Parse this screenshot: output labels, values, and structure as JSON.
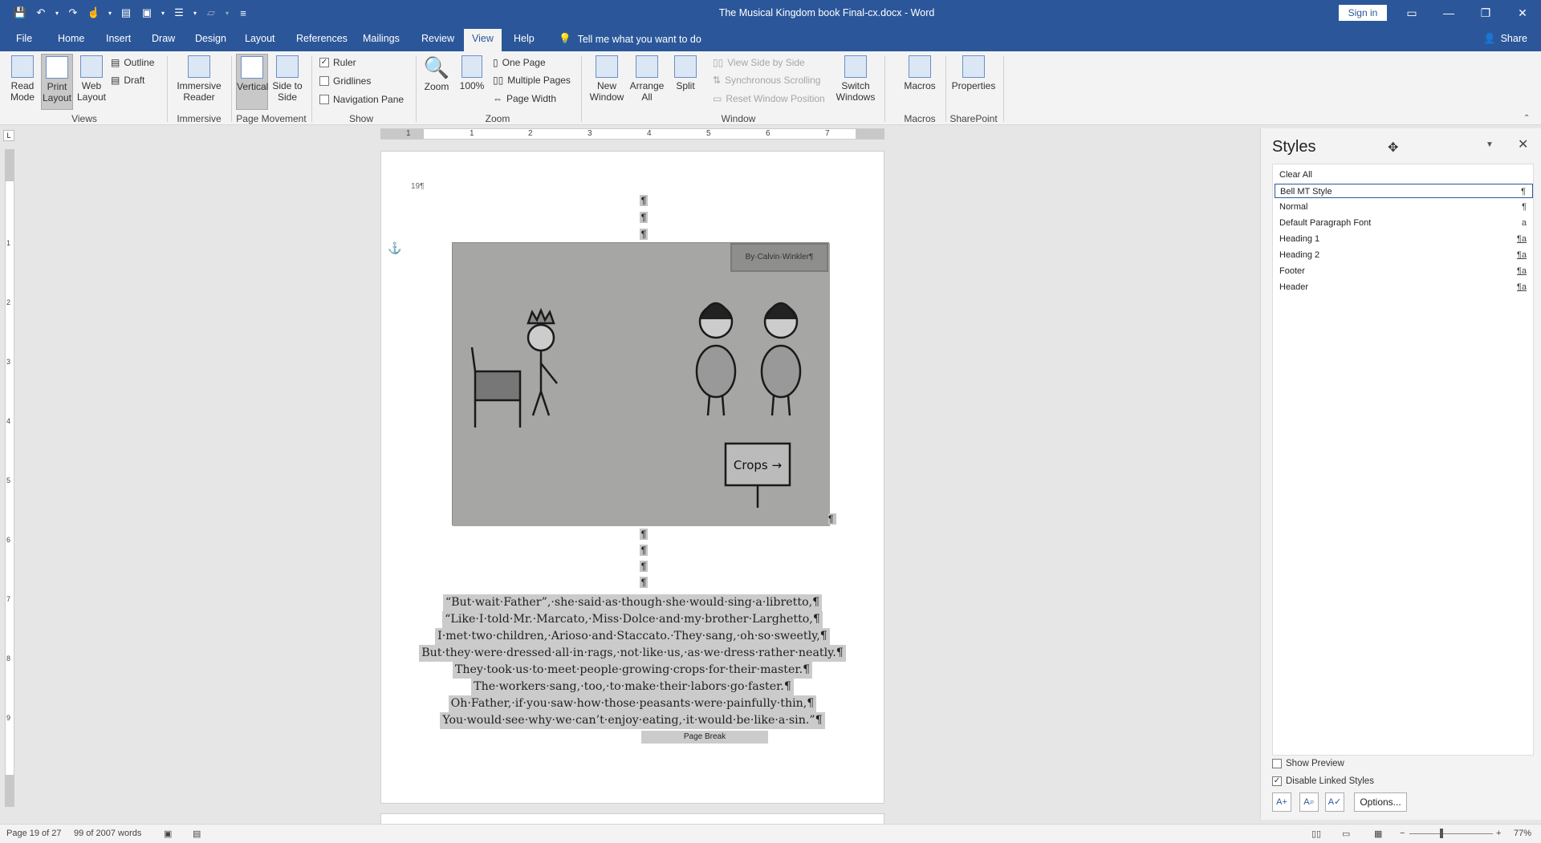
{
  "titlebar": {
    "doc_title": "The Musical Kingdom book Final-cx.docx  -  Word",
    "sign_in": "Sign in"
  },
  "tabs": [
    "File",
    "Home",
    "Insert",
    "Draw",
    "Design",
    "Layout",
    "References",
    "Mailings",
    "Review",
    "View",
    "Help"
  ],
  "active_tab": "View",
  "tell_me": "Tell me what you want to do",
  "share": "Share",
  "ribbon": {
    "views": {
      "read_mode": "Read Mode",
      "print_layout": "Print Layout",
      "web_layout": "Web Layout",
      "outline": "Outline",
      "draft": "Draft",
      "group": "Views"
    },
    "immersive": {
      "reader": "Immersive Reader",
      "group": "Immersive"
    },
    "page_movement": {
      "vertical": "Vertical",
      "side_to_side": "Side to Side",
      "group": "Page Movement"
    },
    "show": {
      "ruler": "Ruler",
      "gridlines": "Gridlines",
      "navigation_pane": "Navigation Pane",
      "group": "Show",
      "ruler_checked": true
    },
    "zoom": {
      "zoom": "Zoom",
      "hundred": "100%",
      "one_page": "One Page",
      "multiple_pages": "Multiple Pages",
      "page_width": "Page Width",
      "group": "Zoom"
    },
    "window": {
      "new_window": "New Window",
      "arrange_all": "Arrange All",
      "split": "Split",
      "view_side_by_side": "View Side by Side",
      "sync_scrolling": "Synchronous Scrolling",
      "reset_window": "Reset Window Position",
      "switch_windows": "Switch Windows",
      "group": "Window"
    },
    "macros": {
      "macros": "Macros",
      "group": "Macros"
    },
    "sharepoint": {
      "properties": "Properties",
      "group": "SharePoint"
    }
  },
  "ruler_numbers": [
    "1",
    "1",
    "2",
    "3",
    "4",
    "5",
    "6",
    "7"
  ],
  "vruler_numbers": [
    "1",
    "2",
    "3",
    "4",
    "5",
    "6",
    "7",
    "8",
    "9"
  ],
  "document": {
    "page_number": "19¶",
    "picture_caption": "By·Calvin·Winkler¶",
    "pilcrow": "¶",
    "verse_lines": [
      "“But·wait·Father”,·she·said·as·though·she·would·sing·a·libretto,¶",
      "“Like·I·told·Mr.·Marcato,·Miss·Dolce·and·my·brother·Larghetto,¶",
      "I·met·two·children,·Arioso·and·Staccato.·They·sang,·oh·so·sweetly,¶",
      "But·they·were·dressed·all·in·rags,·not·like·us,·as·we·dress·rather·neatly.¶",
      "They·took·us·to·meet·people·growing·crops·for·their·master.¶",
      "The·workers·sang,·too,·to·make·their·labors·go·faster.¶",
      "Oh·Father,·if·you·saw·how·those·peasants·were·painfully·thin,¶",
      "You·would·see·why·we·can’t·enjoy·eating,·it·would·be·like·a·sin.”¶"
    ],
    "page_break": "Page Break",
    "drawing_sign": "Crops →"
  },
  "styles_pane": {
    "title": "Styles",
    "items": [
      {
        "name": "Clear All",
        "mark": ""
      },
      {
        "name": "Bell MT Style",
        "mark": "¶"
      },
      {
        "name": "Normal",
        "mark": "¶"
      },
      {
        "name": "Default Paragraph Font",
        "mark": "a"
      },
      {
        "name": "Heading 1",
        "mark": "¶a"
      },
      {
        "name": "Heading 2",
        "mark": "¶a"
      },
      {
        "name": "Footer",
        "mark": "¶a"
      },
      {
        "name": "Header",
        "mark": "¶a"
      }
    ],
    "selected": "Bell MT Style",
    "show_preview": "Show Preview",
    "disable_linked": "Disable Linked Styles",
    "show_preview_checked": false,
    "disable_linked_checked": true,
    "options": "Options..."
  },
  "statusbar": {
    "page": "Page 19 of 27",
    "words": "99 of 2007 words",
    "zoom": "77%"
  },
  "colors": {
    "accent": "#2b579a",
    "selection": "#cbcbcb"
  }
}
